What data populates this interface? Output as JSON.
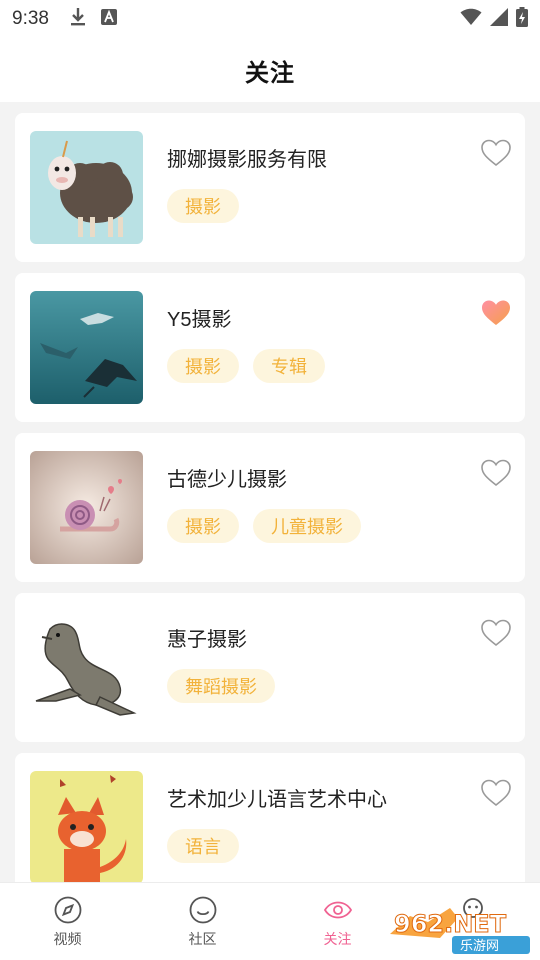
{
  "status_bar": {
    "time": "9:38"
  },
  "header": {
    "title": "关注"
  },
  "cards": [
    {
      "name": "挪娜摄影服务有限",
      "tags": [
        "摄影"
      ],
      "liked": false,
      "thumb": "sheep-illustration"
    },
    {
      "name": "Y5摄影",
      "tags": [
        "摄影",
        "专辑"
      ],
      "liked": true,
      "thumb": "manta-rays-illustration"
    },
    {
      "name": "古德少儿摄影",
      "tags": [
        "摄影",
        "儿童摄影"
      ],
      "liked": false,
      "thumb": "snail-illustration"
    },
    {
      "name": "惠子摄影",
      "tags": [
        "舞蹈摄影"
      ],
      "liked": false,
      "thumb": "sea-lion-illustration"
    },
    {
      "name": "艺术加少儿语言艺术中心",
      "tags": [
        "语言"
      ],
      "liked": false,
      "thumb": "fox-illustration"
    }
  ],
  "tabbar": {
    "items": [
      {
        "label": "视频",
        "icon": "compass-icon"
      },
      {
        "label": "社区",
        "icon": "smile-icon"
      },
      {
        "label": "关注",
        "icon": "eye-icon",
        "active": true
      },
      {
        "label": "",
        "icon": "profile-icon"
      }
    ]
  },
  "watermark": {
    "text": "962.NET",
    "subtext": "乐游网"
  },
  "colors": {
    "tag_bg": "#fdf5dd",
    "tag_text": "#f2b23a",
    "active_tab": "#f06292",
    "heart_filled": "#f56a8a"
  }
}
